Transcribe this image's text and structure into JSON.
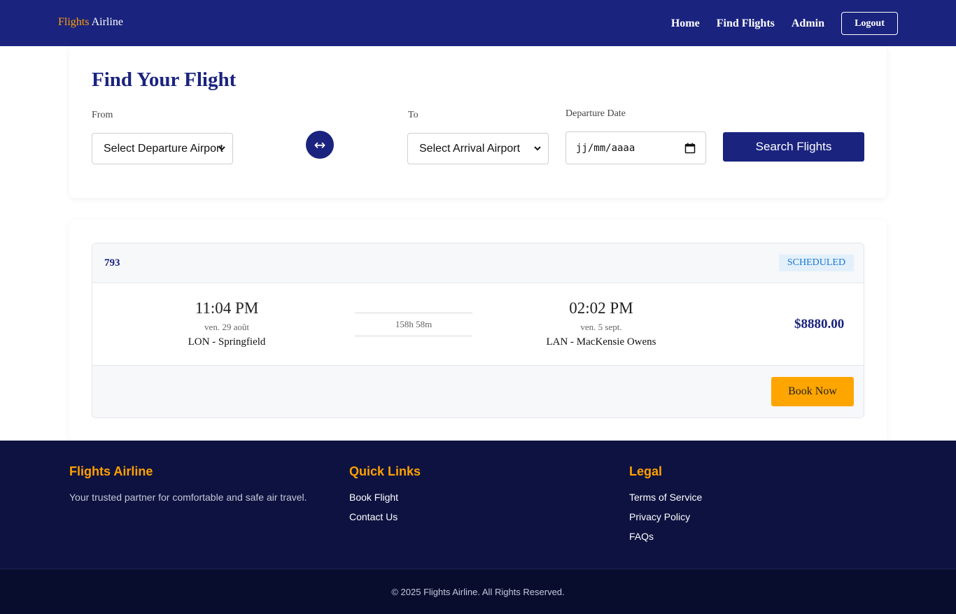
{
  "navbar": {
    "brand_accent": "Flights",
    "brand_rest": "Airline",
    "links": [
      "Home",
      "Find Flights",
      "Admin"
    ],
    "logout_label": "Logout"
  },
  "search": {
    "title": "Find Your Flight",
    "from_label": "From",
    "from_value": "Select Departure Airport",
    "to_label": "To",
    "to_value": "Select Arrival Airport",
    "date_label": "Departure Date",
    "date_placeholder": "jj/mm/aaaa",
    "swap_icon": "↔",
    "search_label": "Search Flights"
  },
  "flight": {
    "number": "793",
    "status": "SCHEDULED",
    "departure": {
      "time": "11:04 PM",
      "date": "ven. 29 août",
      "airport": "LON - Springfield"
    },
    "duration": "158h 58m",
    "arrival": {
      "time": "02:02 PM",
      "date": "ven. 5 sept.",
      "airport": "LAN - MacKensie Owens"
    },
    "price": "$8880.00",
    "book_label": "Book Now"
  },
  "footer": {
    "col1": {
      "heading": "Flights Airline",
      "text": "Your trusted partner for comfortable and safe air travel."
    },
    "col2": {
      "heading": "Quick Links",
      "links": [
        "Book Flight",
        "Contact Us"
      ]
    },
    "col3": {
      "heading": "Legal",
      "links": [
        "Terms of Service",
        "Privacy Policy",
        "FAQs"
      ]
    },
    "copyright": "© 2025 Flights Airline. All Rights Reserved."
  },
  "colors": {
    "primary": "#1a237e",
    "accent": "#ffa000",
    "footer_bg": "#0d1240"
  }
}
